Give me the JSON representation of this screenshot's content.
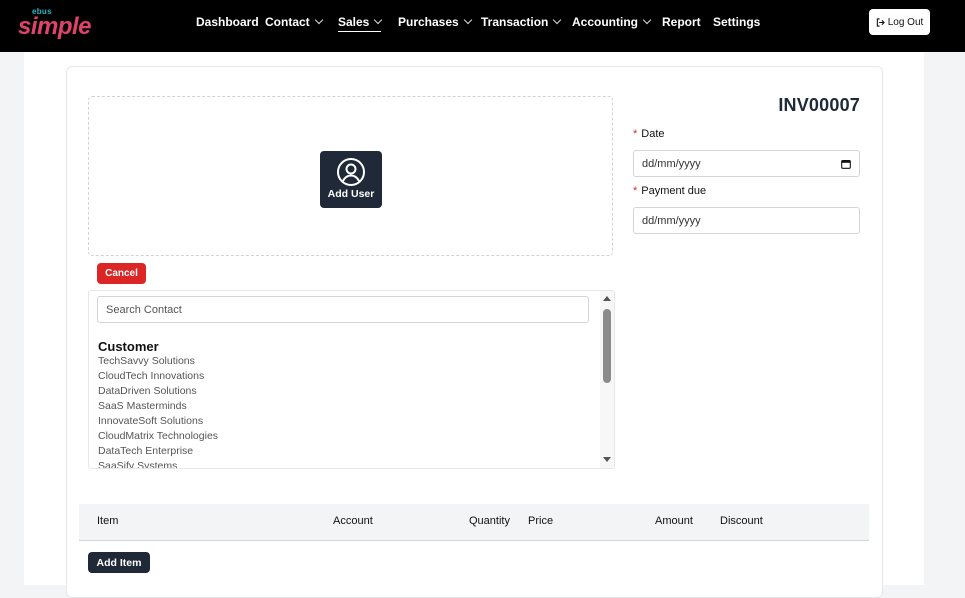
{
  "brand": {
    "small": "ebus",
    "big": "simple"
  },
  "nav": {
    "items": [
      {
        "label": "Dashboard",
        "dropdown": false
      },
      {
        "label": "Contact",
        "dropdown": true
      },
      {
        "label": "Sales",
        "dropdown": true,
        "active": true
      },
      {
        "label": "Purchases",
        "dropdown": true
      },
      {
        "label": "Transaction",
        "dropdown": true
      },
      {
        "label": "Accounting",
        "dropdown": true
      },
      {
        "label": "Report",
        "dropdown": false
      },
      {
        "label": "Settings",
        "dropdown": false
      }
    ],
    "logout": "Log Out"
  },
  "invoice": {
    "number": "INV00007",
    "add_user": "Add User",
    "cancel": "Cancel",
    "date_label": "Date",
    "date_placeholder": "dd/mm/yyyy",
    "payment_due_label": "Payment due",
    "payment_due_placeholder": "dd/mm/yyyy"
  },
  "contacts": {
    "search_placeholder": "Search Contact",
    "group": "Customer",
    "items": [
      "TechSavvy Solutions",
      "CloudTech Innovations",
      "DataDriven Solutions",
      "SaaS Masterminds",
      "InnovateSoft Solutions",
      "CloudMatrix Technologies",
      "DataTech Enterprise",
      "SaaSify Systems"
    ]
  },
  "items_table": {
    "columns": [
      "Item",
      "Account",
      "Quantity",
      "Price",
      "Amount",
      "Discount"
    ],
    "add_item": "Add Item"
  },
  "colors": {
    "nav_bg": "#000000",
    "dark_button": "#1f2937",
    "danger": "#dc2626",
    "brand_pink": "#e0436a",
    "brand_teal": "#2bb7c7"
  }
}
